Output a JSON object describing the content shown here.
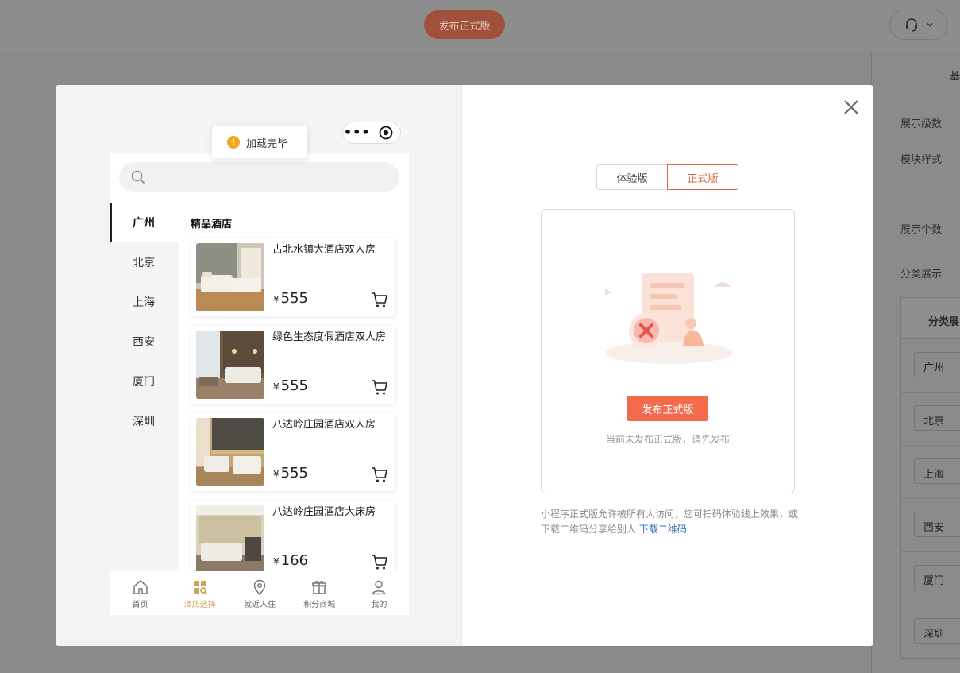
{
  "topbar": {
    "publish_label": "发布正式版"
  },
  "right_panel": {
    "labels": [
      "基",
      "展示级数",
      "模块样式",
      "展示个数",
      "分类展示"
    ],
    "table_header": "分类展",
    "rows": [
      "广州",
      "北京",
      "上海",
      "西安",
      "厦门",
      "深圳"
    ]
  },
  "toast": {
    "text": "加载完毕"
  },
  "phone": {
    "categories": [
      "广州",
      "北京",
      "上海",
      "西安",
      "厦门",
      "深圳"
    ],
    "list_title": "精品酒店",
    "currency": "¥",
    "hotels": [
      {
        "name": "古北水镇大酒店双人房",
        "price": "555"
      },
      {
        "name": "绿色生态度假酒店双人房",
        "price": "555"
      },
      {
        "name": "八达岭庄园酒店双人房",
        "price": "555"
      },
      {
        "name": "八达岭庄园酒店大床房",
        "price": "166"
      }
    ],
    "tabs": [
      {
        "label": "首页",
        "icon": "home-icon"
      },
      {
        "label": "酒店选择",
        "icon": "grid-search-icon"
      },
      {
        "label": "就近入住",
        "icon": "location-pin-icon"
      },
      {
        "label": "积分商城",
        "icon": "gift-icon"
      },
      {
        "label": "我的",
        "icon": "user-icon"
      }
    ],
    "active_tab_color": "#c9a45c"
  },
  "version_switch": {
    "trial": "体验版",
    "release": "正式版",
    "accent": "#e0643f"
  },
  "release_panel": {
    "publish_button": "发布正式版",
    "hint": "当前未发布正式版，请先发布",
    "description": "小程序正式版允许被所有人访问，您可扫码体验线上效果，或下载二维码分享给别人",
    "download_link": "下载二维码"
  }
}
